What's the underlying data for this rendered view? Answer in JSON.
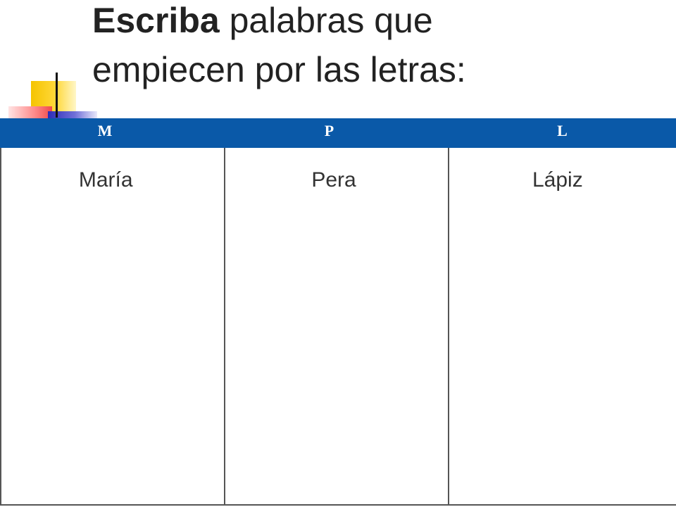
{
  "title": {
    "bold": "Escriba",
    "line1_rest": " palabras que",
    "line2": "empiecen por las letras:"
  },
  "table": {
    "headers": [
      "M",
      "P",
      "L"
    ],
    "words": [
      "María",
      "Pera",
      "Lápiz"
    ]
  },
  "colors": {
    "header_background": "#0a59a8",
    "accent_yellow": "#f5c400",
    "accent_red": "#f04a4a",
    "accent_blue": "#2d2db8"
  }
}
